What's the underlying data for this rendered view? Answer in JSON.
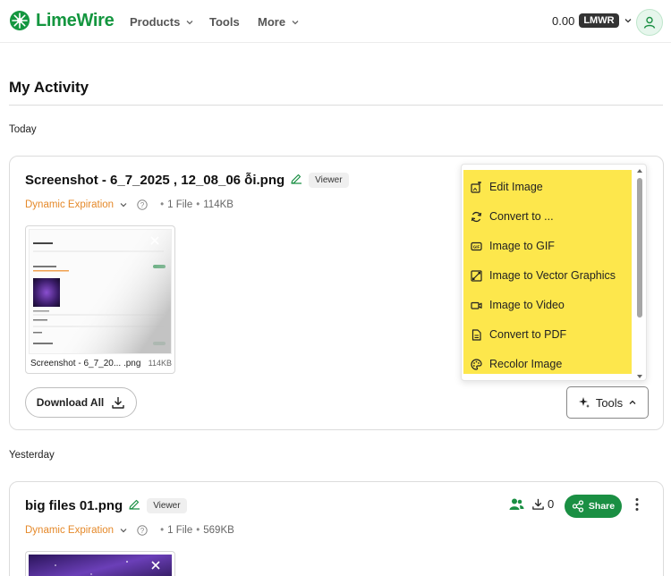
{
  "app": {
    "name": "LimeWire",
    "brand_color": "#14963f"
  },
  "nav": {
    "items": [
      {
        "label": "Products",
        "has_dropdown": true
      },
      {
        "label": "Tools",
        "has_dropdown": false
      },
      {
        "label": "More",
        "has_dropdown": true
      }
    ],
    "balance": {
      "amount": "0.00",
      "token": "LMWR"
    },
    "avatar_icon": "user-icon"
  },
  "page": {
    "title": "My Activity"
  },
  "sections": [
    {
      "label": "Today"
    },
    {
      "label": "Yesterday"
    }
  ],
  "cards": [
    {
      "file_name": "Screenshot - 6_7_2025 , 12_08_06 ỗi.png",
      "badge": "Viewer",
      "expiration": "Dynamic Expiration",
      "file_count": "1 File",
      "total_size": "114KB",
      "thumbnail": {
        "name": "Screenshot - 6_7_20... .png",
        "size": "114KB"
      },
      "download_all_label": "Download All",
      "tools_label": "Tools"
    },
    {
      "file_name": "big files 01.png",
      "badge": "Viewer",
      "expiration": "Dynamic Expiration",
      "file_count": "1 File",
      "total_size": "569KB",
      "download_count": "0",
      "share_label": "Share"
    }
  ],
  "tools_menu": {
    "highlight_color": "#fde74c",
    "items": [
      {
        "label": "Edit Image",
        "icon": "edit-image-icon"
      },
      {
        "label": "Convert to ...",
        "icon": "convert-icon"
      },
      {
        "label": "Image to GIF",
        "icon": "gif-icon"
      },
      {
        "label": "Image to Vector Graphics",
        "icon": "vector-icon"
      },
      {
        "label": "Image to Video",
        "icon": "video-icon"
      },
      {
        "label": "Convert to PDF",
        "icon": "pdf-icon"
      },
      {
        "label": "Recolor Image",
        "icon": "palette-icon"
      }
    ]
  }
}
